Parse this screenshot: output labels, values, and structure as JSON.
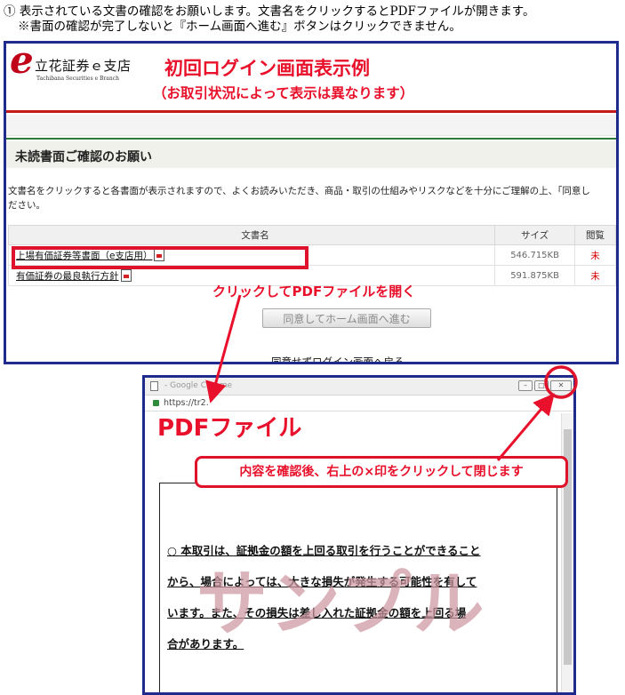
{
  "instructions": {
    "line1": "① 表示されている文書の確認をお願いします。文書名をクリックするとPDFファイルが開きます。",
    "line2": "※書面の確認が完了しないと『ホーム画面へ進む』ボタンはクリックできません。"
  },
  "login_screen": {
    "logo": {
      "letter": "e",
      "name": "立花証券ｅ支店",
      "sub": "Tachibana Securities e Branch"
    },
    "banner_title": "初回ログイン画面表示例",
    "banner_note": "（お取引状況によって表示は異なります）",
    "section_title": "未読書面ご確認のお願い",
    "description": "文書名をクリックすると各書面が表示されますので、よくお読みいただき、商品・取引の仕組みやリスクなどを十分にご理解の上、「同意し\nださい。",
    "table": {
      "headers": [
        "文書名",
        "サイズ",
        "閲覧"
      ],
      "rows": [
        {
          "name": "上場有価証券等書面（e支店用）",
          "size": "546.715KB",
          "status": "未"
        },
        {
          "name": "有価証券の最良執行方針",
          "size": "591.875KB",
          "status": "未"
        }
      ]
    },
    "callout_click": "クリックしてPDFファイルを開く",
    "agree_button": "同意してホーム画面へ進む",
    "back_link": "同意せずログイン画面へ戻る"
  },
  "pdf_window": {
    "tab_title": "- Google Chrome",
    "url": "https://tr2.",
    "window_controls": {
      "minimize": "–",
      "maximize": "□",
      "close": "✕"
    },
    "label": "PDFファイル",
    "callout_close": "内容を確認後、右上の×印をクリックして閉じます",
    "doc_lines": [
      "○ 本取引は、証拠金の額を上回る取引を行うことができること",
      "から、場合によっては、大きな損失が発生する可能性を有して",
      "います。また、その損失は差し入れた証拠金の額を上回る場",
      "合があります。"
    ],
    "watermark": "サンプル"
  },
  "colors": {
    "accent_red": "#e8102a",
    "frame_blue": "#1e2a8c",
    "green_rule": "#2f7a3a"
  },
  "icons": [
    "pdf-file-icon",
    "lock-icon",
    "document-icon"
  ]
}
